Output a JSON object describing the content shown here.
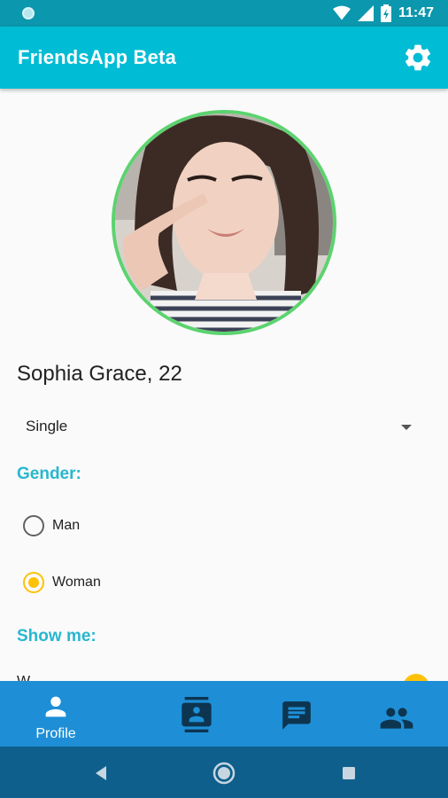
{
  "status_bar": {
    "time": "11:47",
    "icons": [
      "notification-dot-icon",
      "wifi-icon",
      "signal-icon",
      "battery-charging-icon"
    ]
  },
  "app_bar": {
    "title": "FriendsApp Beta",
    "action_icon": "gear-icon"
  },
  "profile": {
    "photo": "profile-photo",
    "name_age": "Sophia Grace, 22",
    "relationship_status": {
      "selected": "Single"
    },
    "gender": {
      "label": "Gender:",
      "options": [
        {
          "label": "Man",
          "checked": false
        },
        {
          "label": "Woman",
          "checked": true
        }
      ]
    },
    "show_me": {
      "label": "Show me:",
      "partially_visible_text": "W"
    }
  },
  "bottom_nav": {
    "items": [
      {
        "icon": "person-icon",
        "label": "Profile",
        "active": true
      },
      {
        "icon": "contacts-icon",
        "label": "",
        "active": false
      },
      {
        "icon": "chat-icon",
        "label": "",
        "active": false
      },
      {
        "icon": "people-icon",
        "label": "",
        "active": false
      }
    ]
  },
  "colors": {
    "status_bar": "#0b97ad",
    "app_bar": "#00bcd4",
    "accent_label": "#28b7cf",
    "radio_selected": "#ffc107",
    "avatar_border": "#5cd36f",
    "bottom_nav": "#1e8fd6",
    "system_nav": "#0e5f8c"
  }
}
